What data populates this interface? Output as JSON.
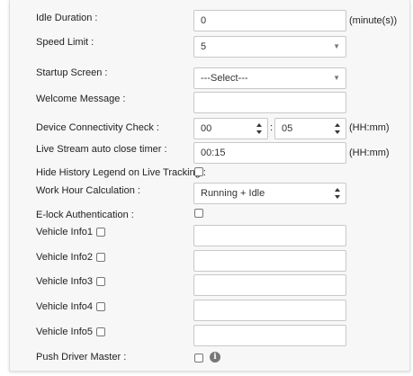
{
  "settings": {
    "idle_duration": {
      "label": "Idle Duration :",
      "value": "0",
      "unit": "(minute(s))"
    },
    "speed_limit": {
      "label": "Speed Limit :",
      "value": "5"
    },
    "startup_screen": {
      "label": "Startup Screen :",
      "value": "---Select---"
    },
    "welcome_message": {
      "label": "Welcome Message :",
      "value": ""
    },
    "device_connectivity_check": {
      "label": "Device Connectivity Check :",
      "hours": "00",
      "separator": ":",
      "minutes": "05",
      "unit": "(HH:mm)"
    },
    "live_stream_close_timer": {
      "label": "Live Stream auto close timer :",
      "value": "00:15",
      "unit": "(HH:mm)"
    },
    "hide_history_legend": {
      "label": "Hide History Legend on Live Tracking :",
      "checked": false
    },
    "work_hour_calculation": {
      "label": "Work Hour Calculation :",
      "value": "Running + Idle"
    },
    "elock_authentication": {
      "label": "E-lock Authentication :",
      "checked": false
    },
    "vehicle_infos": [
      {
        "label": "Vehicle Info1 :",
        "checked": false,
        "value": ""
      },
      {
        "label": "Vehicle Info2 :",
        "checked": false,
        "value": ""
      },
      {
        "label": "Vehicle Info3 :",
        "checked": false,
        "value": ""
      },
      {
        "label": "Vehicle Info4 :",
        "checked": false,
        "value": ""
      },
      {
        "label": "Vehicle Info5 :",
        "checked": false,
        "value": ""
      }
    ],
    "push_driver_master": {
      "label": "Push Driver Master :",
      "checked": false,
      "info_icon": "info-icon",
      "info_glyph": "i"
    }
  }
}
